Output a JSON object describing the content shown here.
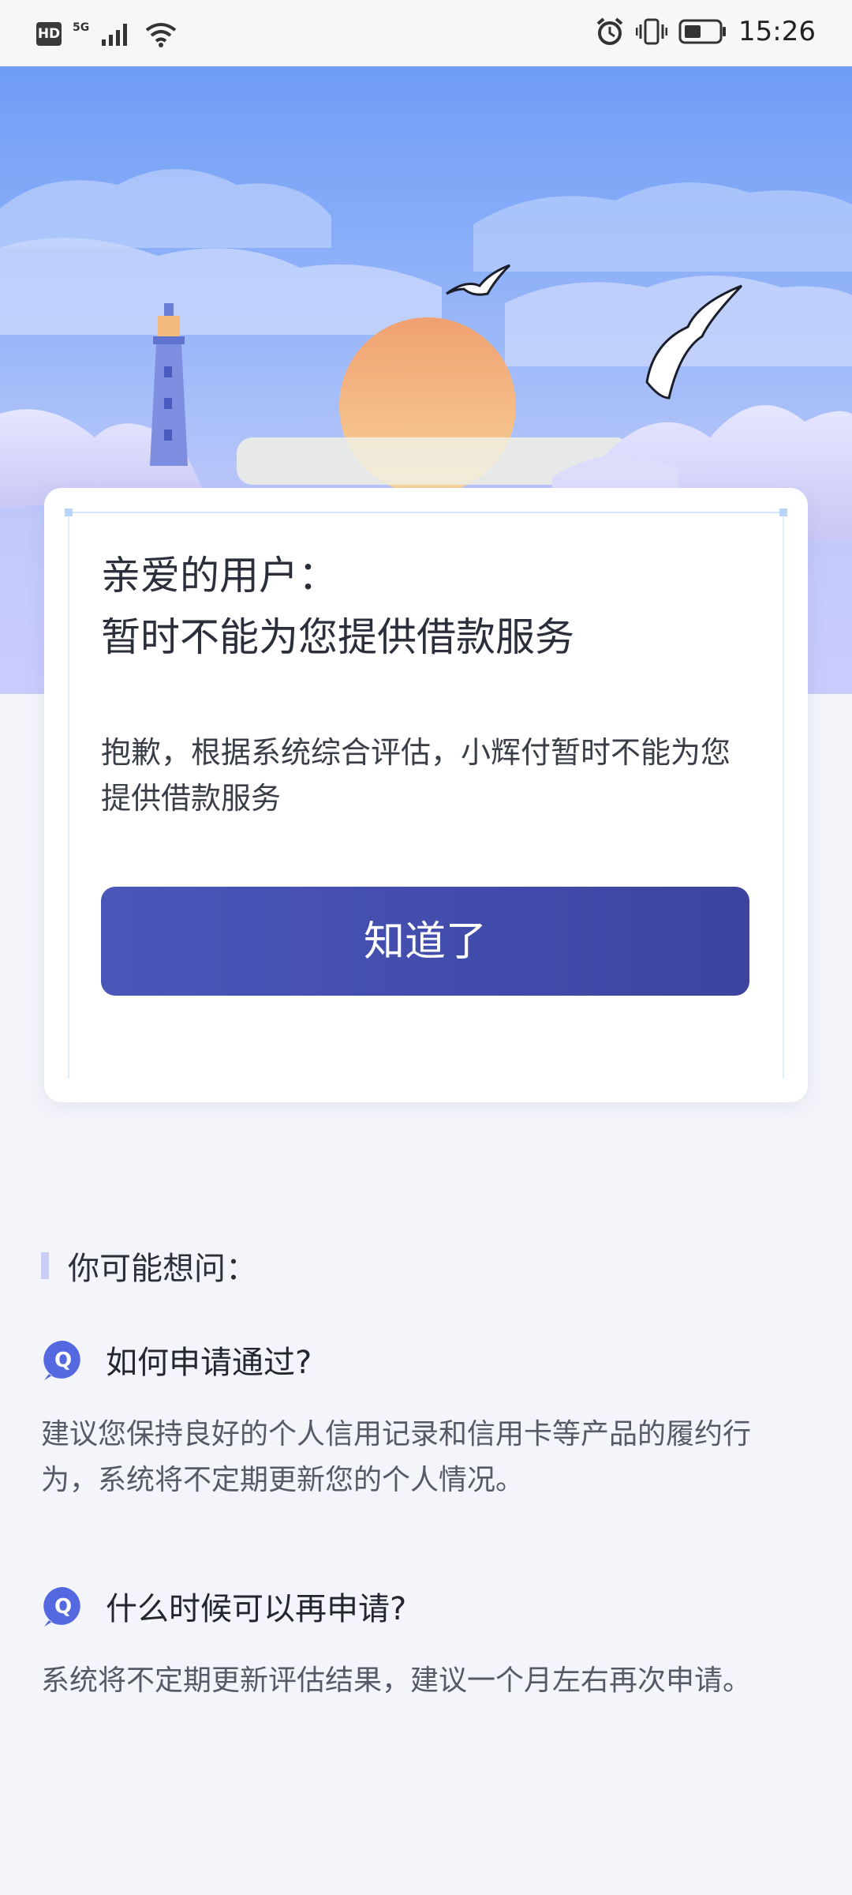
{
  "status_bar": {
    "hd": "HD",
    "network": "5G",
    "time": "15:26",
    "icons": [
      "hd-icon",
      "signal-icon",
      "wifi-icon",
      "alarm-icon",
      "vibrate-icon",
      "battery-icon"
    ]
  },
  "hero": {
    "elements": [
      "sky",
      "clouds",
      "lighthouse",
      "sun",
      "seagull-small",
      "seagull-large",
      "mountains"
    ],
    "colors": {
      "sky_top": "#6f9cf5",
      "sky_bottom": "#c9cbfb",
      "sun": "#f3b27e"
    }
  },
  "card": {
    "title_line1": "亲爱的用户：",
    "title_line2": "暂时不能为您提供借款服务",
    "message": "抱歉，根据系统综合评估，小辉付暂时不能为您提供借款服务",
    "button_label": "知道了",
    "button_color": "#4451ad"
  },
  "faq": {
    "heading": "你可能想问：",
    "q_icon_label": "Q",
    "items": [
      {
        "question": "如何申请通过?",
        "answer": "建议您保持良好的个人信用记录和信用卡等产品的履约行为，系统将不定期更新您的个人情况。"
      },
      {
        "question": "什么时候可以再申请?",
        "answer": "系统将不定期更新评估结果，建议一个月左右再次申请。"
      }
    ]
  }
}
